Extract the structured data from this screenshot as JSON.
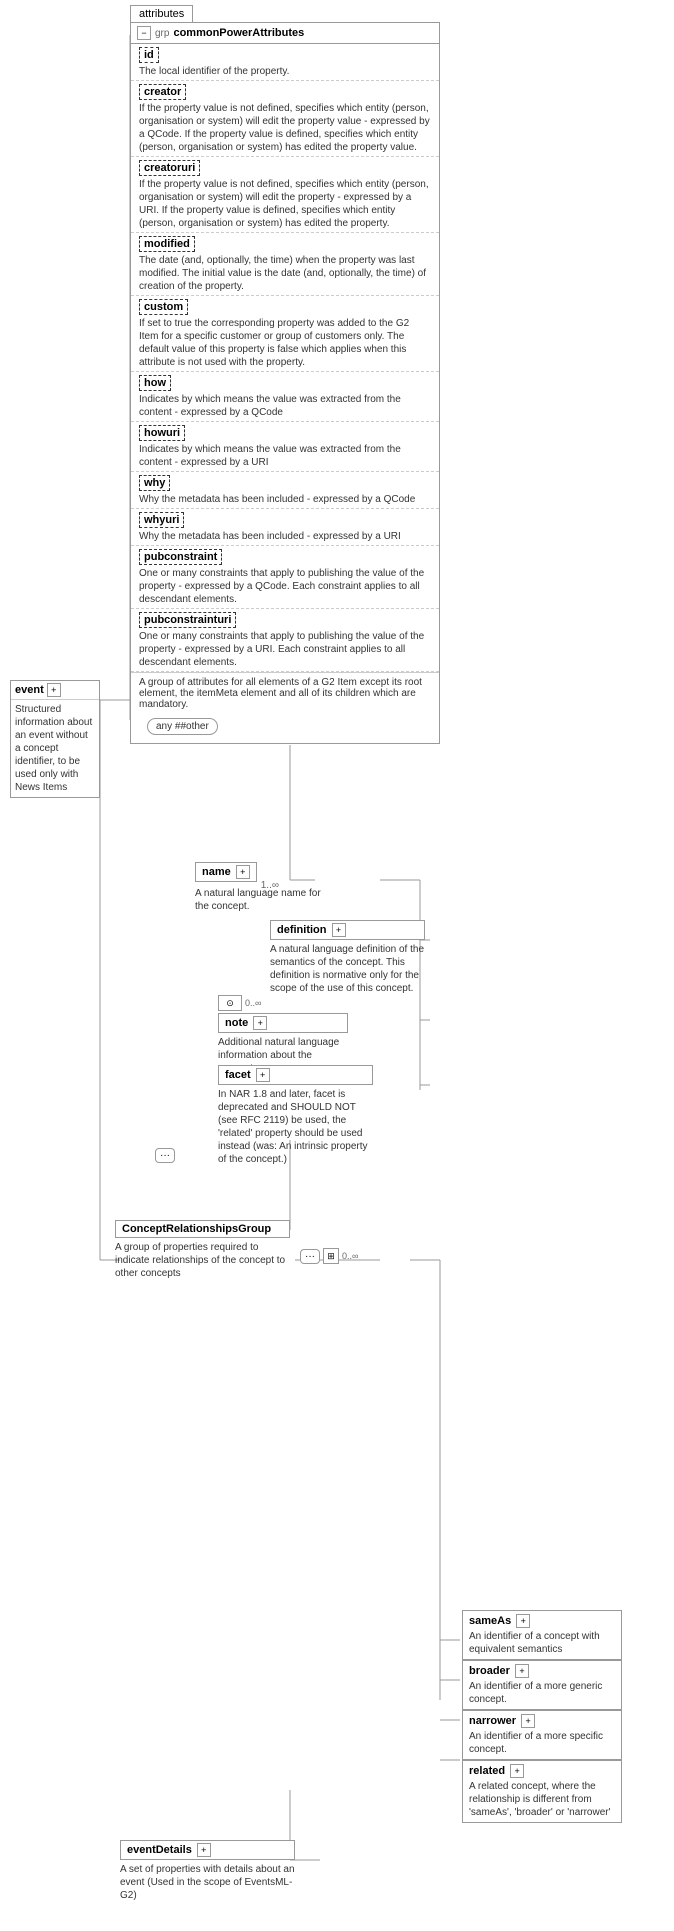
{
  "title": "attributes",
  "commonPowerBox": {
    "prefix": "grp",
    "title": "commonPowerAttributes",
    "attributes": [
      {
        "name": "id",
        "desc": "The local identifier of the property."
      },
      {
        "name": "creator",
        "desc": "If the property value is not defined, specifies which entity (person, organisation or system) will edit the property value - expressed by a QCode. If the property value is defined, specifies which entity (person, organisation or system) has edited the property value."
      },
      {
        "name": "creatoruri",
        "desc": "If the property value is not defined, specifies which entity (person, organisation or system) will edit the property - expressed by a URI. If the property value is defined, specifies which entity (person, organisation or system) has edited the property."
      },
      {
        "name": "modified",
        "desc": "The date (and, optionally, the time) when the property was last modified. The initial value is the date (and, optionally, the time) of creation of the property."
      },
      {
        "name": "custom",
        "desc": "If set to true the corresponding property was added to the G2 Item for a specific customer or group of customers only. The default value of this property is false which applies when this attribute is not used with the property."
      },
      {
        "name": "how",
        "desc": "Indicates by which means the value was extracted from the content - expressed by a QCode"
      },
      {
        "name": "howuri",
        "desc": "Indicates by which means the value was extracted from the content - expressed by a URI"
      },
      {
        "name": "why",
        "desc": "Why the metadata has been included - expressed by a QCode"
      },
      {
        "name": "whyuri",
        "desc": "Why the metadata has been included - expressed by a URI"
      },
      {
        "name": "pubconstraint",
        "desc": "One or many constraints that apply to publishing the value of the property - expressed by a QCode. Each constraint applies to all descendant elements."
      },
      {
        "name": "pubconstrainturi",
        "desc": "One or many constraints that apply to publishing the value of the property - expressed by a URI. Each constraint applies to all descendant elements."
      }
    ],
    "bottomDesc": "A group of attributes for all elements of a G2 Item except its root element, the itemMeta element and all of its children which are mandatory.",
    "anyOther": "any ##other"
  },
  "eventBox": {
    "name": "event",
    "desc": "Structured information about an event without a concept identifier, to be used only with News Items"
  },
  "nameNode": {
    "label": "name",
    "multiplicity": "1..∞",
    "desc": "A natural language name for the concept."
  },
  "definitionNode": {
    "label": "definition",
    "desc": "A natural language definition of the semantics of the concept. This definition is normative only for the scope of the use of this concept."
  },
  "noteNode": {
    "label": "note",
    "multiplicity": "0..∞",
    "desc": "Additional natural language information about the concept."
  },
  "facetNode": {
    "label": "facet",
    "desc": "In NAR 1.8 and later, facet is deprecated and SHOULD NOT (see RFC 2119) be used, the 'related' property should be used instead (was: An intrinsic property of the concept.)"
  },
  "crgBox": {
    "label": "ConceptRelationshipsGroup",
    "desc": "A group of properties required to indicate relationships of the concept to other concepts"
  },
  "sameAsNode": {
    "label": "sameAs",
    "desc": "An identifier of a concept with equivalent semantics"
  },
  "broaderNode": {
    "label": "broader",
    "desc": "An identifier of a more generic concept."
  },
  "narrowerNode": {
    "label": "narrower",
    "desc": "An identifier of a more specific concept."
  },
  "relatedNode": {
    "label": "related",
    "desc": "A related concept, where the relationship is different from 'sameAs', 'broader' or 'narrower'"
  },
  "eventDetailsBox": {
    "label": "eventDetails",
    "desc": "A set of properties with details about an event (Used in the scope of EventsML-G2)"
  }
}
